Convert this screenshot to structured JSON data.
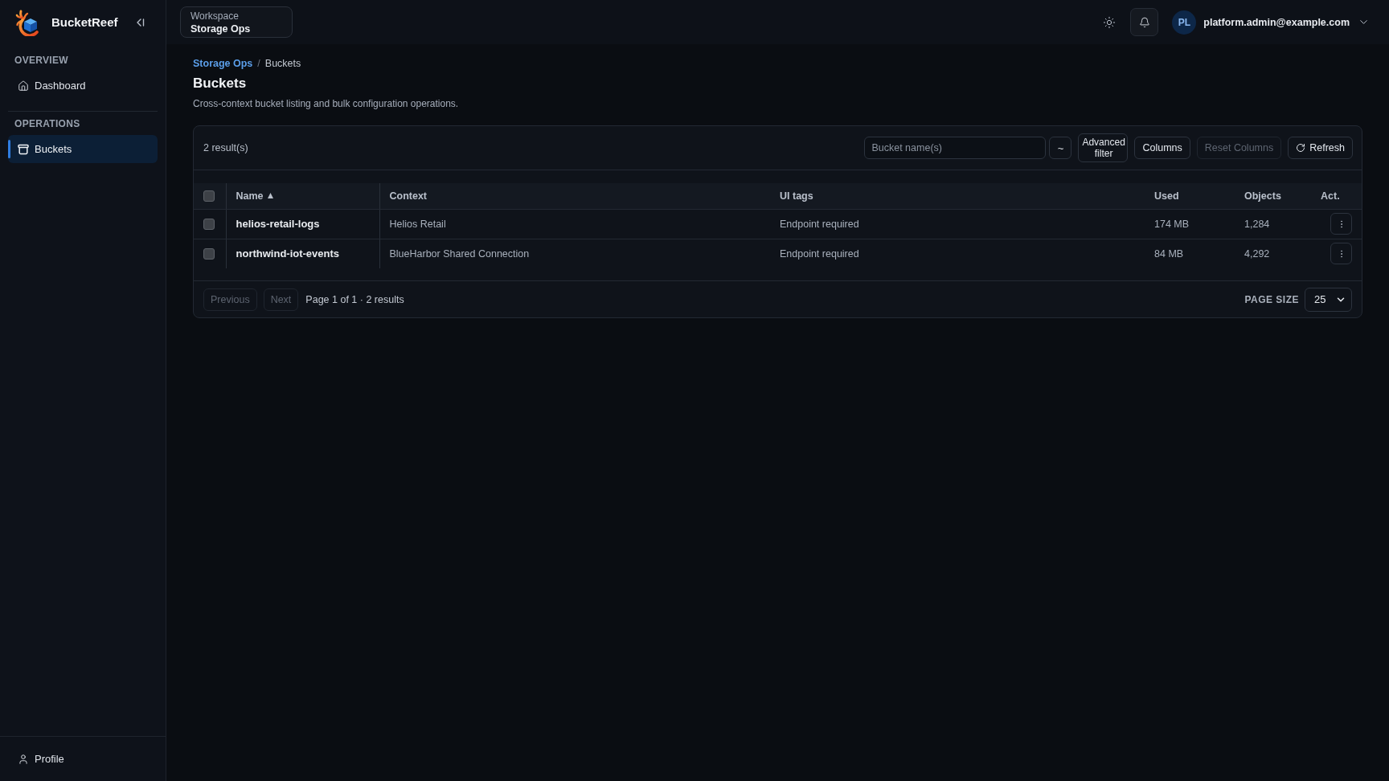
{
  "app": {
    "name": "BucketReef"
  },
  "workspace": {
    "label": "Workspace",
    "value": "Storage Ops"
  },
  "sidebar": {
    "sections": [
      {
        "heading": "OVERVIEW",
        "items": [
          {
            "label": "Dashboard",
            "kind": "home",
            "selected": false
          }
        ]
      },
      {
        "heading": "OPERATIONS",
        "items": [
          {
            "label": "Buckets",
            "kind": "bucket",
            "selected": true
          }
        ]
      }
    ],
    "footer": {
      "label": "Profile"
    }
  },
  "user": {
    "initials": "PL",
    "email": "platform.admin@example.com"
  },
  "breadcrumb": {
    "separator": "/",
    "items": [
      {
        "label": "Storage Ops",
        "kind": "link"
      },
      {
        "label": "Buckets",
        "kind": "current"
      }
    ]
  },
  "page": {
    "title": "Buckets",
    "description": "Cross-context bucket listing and bulk configuration operations."
  },
  "toolbar": {
    "result_count": "2 result(s)",
    "search": {
      "placeholder": "Bucket name(s)"
    },
    "filter_toggle": {
      "label": "~"
    },
    "buttons": [
      {
        "label": "Advanced filter",
        "kind": "stacked",
        "disabled": false
      },
      {
        "label": "Columns",
        "kind": "plain",
        "disabled": false
      },
      {
        "label": "Reset Columns",
        "kind": "plain",
        "disabled": true
      },
      {
        "label": "Refresh",
        "kind": "refresh",
        "disabled": false
      }
    ]
  },
  "table": {
    "select_all": {
      "checked": false
    },
    "columns": [
      {
        "label": "Name",
        "sorted": true
      },
      {
        "label": "Context",
        "sorted": false
      },
      {
        "label": "UI tags",
        "sorted": false
      },
      {
        "label": "Used",
        "sorted": false
      },
      {
        "label": "Objects",
        "sorted": false
      },
      {
        "label": "Act.",
        "sorted": false
      }
    ],
    "rows": [
      {
        "checked": false,
        "name": "helios-retail-logs",
        "context": "Helios Retail",
        "ui_tags": "Endpoint required",
        "used": "174 MB",
        "objects": "1,284"
      },
      {
        "checked": false,
        "name": "northwind-iot-events",
        "context": "BlueHarbor Shared Connection",
        "ui_tags": "Endpoint required",
        "used": "84 MB",
        "objects": "4,292"
      }
    ]
  },
  "pagination": {
    "previous": {
      "label": "Previous",
      "disabled": true
    },
    "next": {
      "label": "Next",
      "disabled": true
    },
    "summary": "Page 1 of 1 · 2 results",
    "page_size_label": "PAGE SIZE",
    "page_size": "25"
  }
}
